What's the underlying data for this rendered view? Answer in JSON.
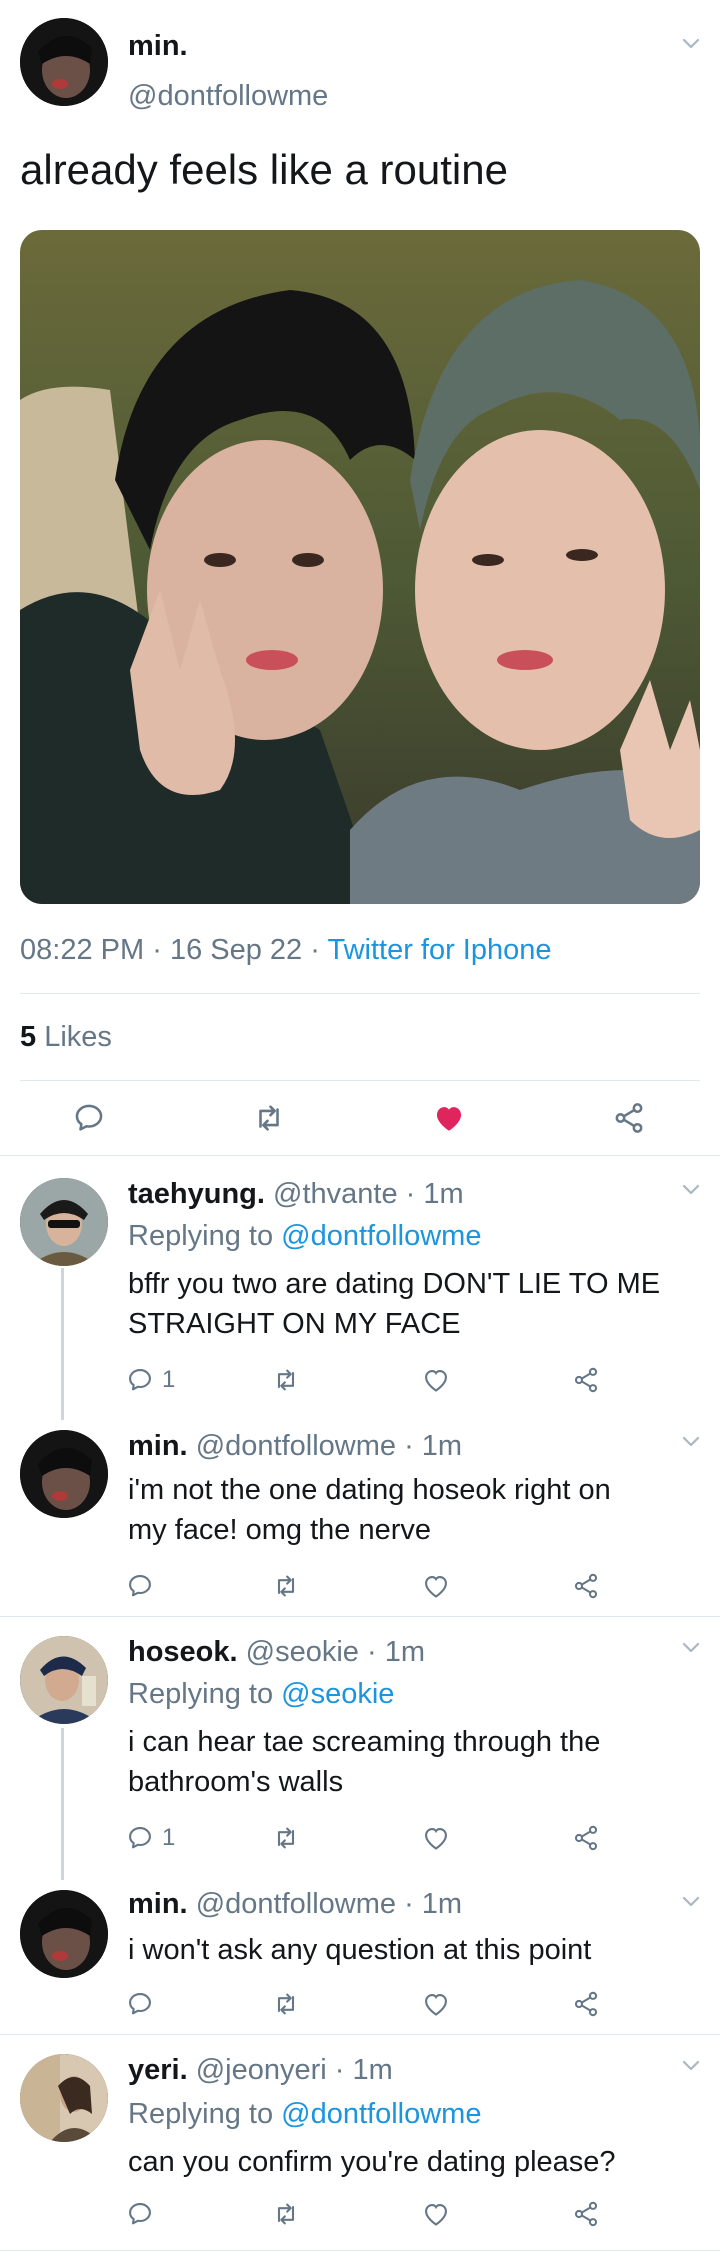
{
  "tweet": {
    "display_name": "min.",
    "handle": "@dontfollowme",
    "text": "already feels like a routine",
    "time": "08:22 PM",
    "sep1": "·",
    "date": "16 Sep 22",
    "sep2": "·",
    "source": "Twitter for Iphone",
    "likes_count": "5",
    "likes_label": "Likes"
  },
  "colors": {
    "link": "#1b95e0",
    "muted": "#657786",
    "like_active": "#e0245e",
    "divider": "#e1e8ed"
  },
  "replies": [
    {
      "name": "taehyung.",
      "handle": "@thvante",
      "time": "· 1m",
      "replying_prefix": "Replying to",
      "replying_to": "@dontfollowme",
      "line1": "bffr you two are dating DON'T LIE TO ME",
      "line2": "STRAIGHT ON MY FACE",
      "reply_count": "1"
    },
    {
      "name": "min.",
      "handle": "@dontfollowme",
      "time": "· 1m",
      "line1": "i'm not the one dating hoseok right on",
      "line2": "my face! omg the nerve"
    },
    {
      "name": "hoseok.",
      "handle": "@seokie",
      "time": "· 1m",
      "replying_prefix": "Replying to",
      "replying_to": "@seokie",
      "line1": "i can hear tae screaming through the",
      "line2": "bathroom's walls",
      "reply_count": "1"
    },
    {
      "name": "min.",
      "handle": "@dontfollowme",
      "time": "· 1m",
      "line1": "i won't ask any question at this point"
    },
    {
      "name": "yeri.",
      "handle": "@jeonyeri",
      "time": "· 1m",
      "replying_prefix": "Replying to",
      "replying_to": "@dontfollowme",
      "line1": "can you confirm you're dating please?"
    }
  ],
  "icons": [
    "chevron-down-icon",
    "reply-icon",
    "retweet-icon",
    "like-icon",
    "share-icon"
  ]
}
